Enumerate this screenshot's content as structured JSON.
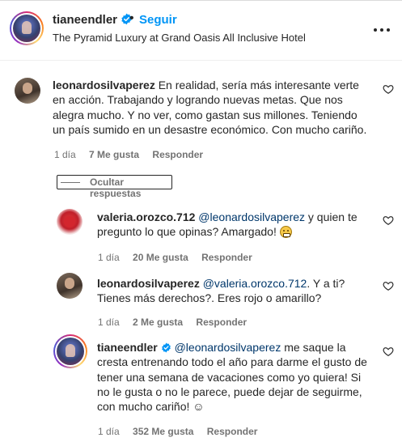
{
  "header": {
    "username": "tianeendler",
    "separator": "•",
    "follow_label": "Seguir",
    "location": "The Pyramid Luxury at Grand Oasis All Inclusive Hotel",
    "avatar_icon": "profile-photo",
    "more_icon": "more-options-icon"
  },
  "comments": [
    {
      "username": "leonardosilvaperez",
      "text": "En realidad, sería más interesante verte en acción. Trabajando y logrando nuevas metas. Que nos alegra mucho. Y no ver, como gastan sus millones. Teniendo un país sumido en un desastre económico. Con mucho cariño.",
      "time": "1 día",
      "likes": "7 Me gusta",
      "reply": "Responder"
    }
  ],
  "hide_replies_label": "Ocultar respuestas",
  "replies": [
    {
      "username": "valeria.orozco.712",
      "mention": "@leonardosilvaperez",
      "text": " y quien te pregunto lo que opinas? Amargado!",
      "emoji": "grimacing-face",
      "time": "1 día",
      "likes": "20 Me gusta",
      "reply": "Responder"
    },
    {
      "username": "leonardosilvaperez",
      "mention": "@valeria.orozco.712",
      "text": ". Y a ti? Tienes más derechos?. Eres rojo o amarillo?",
      "time": "1 día",
      "likes": "2 Me gusta",
      "reply": "Responder"
    },
    {
      "username": "tianeendler",
      "mention": "@leonardosilvaperez",
      "text": " me saque la cresta entrenando todo el año para darme el gusto de tener una semana de vacaciones como yo quiera! Si no le gusta o no le parece, puede dejar de seguirme, con mucho cariño! ☺",
      "time": "1 día",
      "likes": "352 Me gusta",
      "reply": "Responder"
    }
  ],
  "colors": {
    "link_blue": "#0095f6",
    "mention": "#00376b",
    "secondary_text": "#737373",
    "primary_text": "#262626",
    "verified_badge": "#0095f6"
  }
}
